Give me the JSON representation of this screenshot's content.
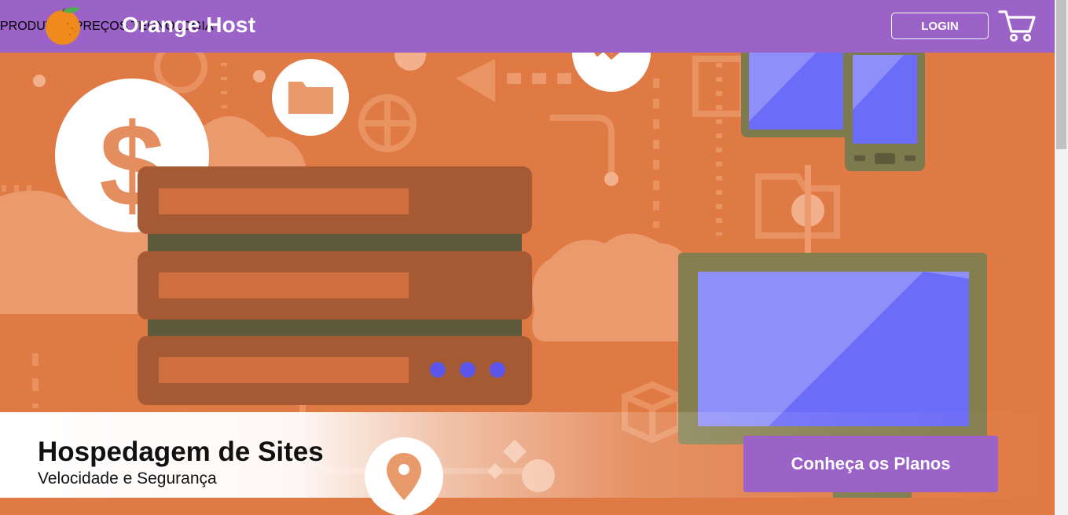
{
  "header": {
    "brand": "Orange Host",
    "nav": [
      {
        "label": "PRODUTOS"
      },
      {
        "label": "PREÇOS"
      },
      {
        "label": "TECNOLOGIA"
      }
    ],
    "login_label": "LOGIN"
  },
  "hero": {
    "title": "Hospedagem de Sites",
    "subtitle": "Velocidade e Segurança",
    "cta_label": "Conheça os Planos",
    "icons": [
      "dollar-icon",
      "folder-icon",
      "map-pin-icon",
      "server-icon",
      "monitor-icon",
      "phone-icon",
      "cloud-icon"
    ]
  },
  "colors": {
    "header_bg": "#9b62c8",
    "hero_bg": "#e07a44",
    "server": "#a55a33",
    "screen": "#6b6cf7"
  }
}
